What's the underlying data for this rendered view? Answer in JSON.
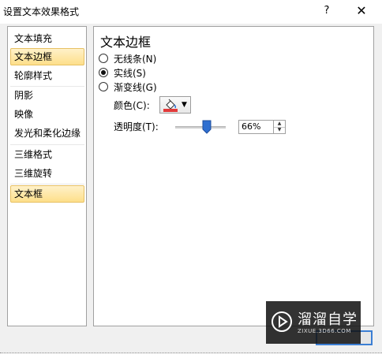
{
  "window": {
    "title": "设置文本效果格式",
    "help_glyph": "?",
    "close_glyph": "✕"
  },
  "sidebar": {
    "items": [
      {
        "label": "文本填充",
        "selected": false
      },
      {
        "label": "文本边框",
        "selected": true
      },
      {
        "label": "轮廓样式",
        "selected": false
      },
      {
        "label": "阴影",
        "selected": false
      },
      {
        "label": "映像",
        "selected": false
      },
      {
        "label": "发光和柔化边缘",
        "selected": false
      },
      {
        "label": "三维格式",
        "selected": false
      },
      {
        "label": "三维旋转",
        "selected": false
      },
      {
        "label": "文本框",
        "selected": false
      }
    ]
  },
  "content": {
    "section_title": "文本边框",
    "radios": [
      {
        "label": "无线条(N)",
        "checked": false
      },
      {
        "label": "实线(S)",
        "checked": true
      },
      {
        "label": "渐变线(G)",
        "checked": false
      }
    ],
    "color_label": "颜色(C):",
    "color_value": "#e23a3a",
    "transparency_label": "透明度(T):",
    "transparency_value": "66%",
    "transparency_fraction": 0.66
  },
  "footer": {
    "close_label": ""
  },
  "watermark": {
    "title": "溜溜自学",
    "url": "ZIXUE.3D66.COM"
  }
}
